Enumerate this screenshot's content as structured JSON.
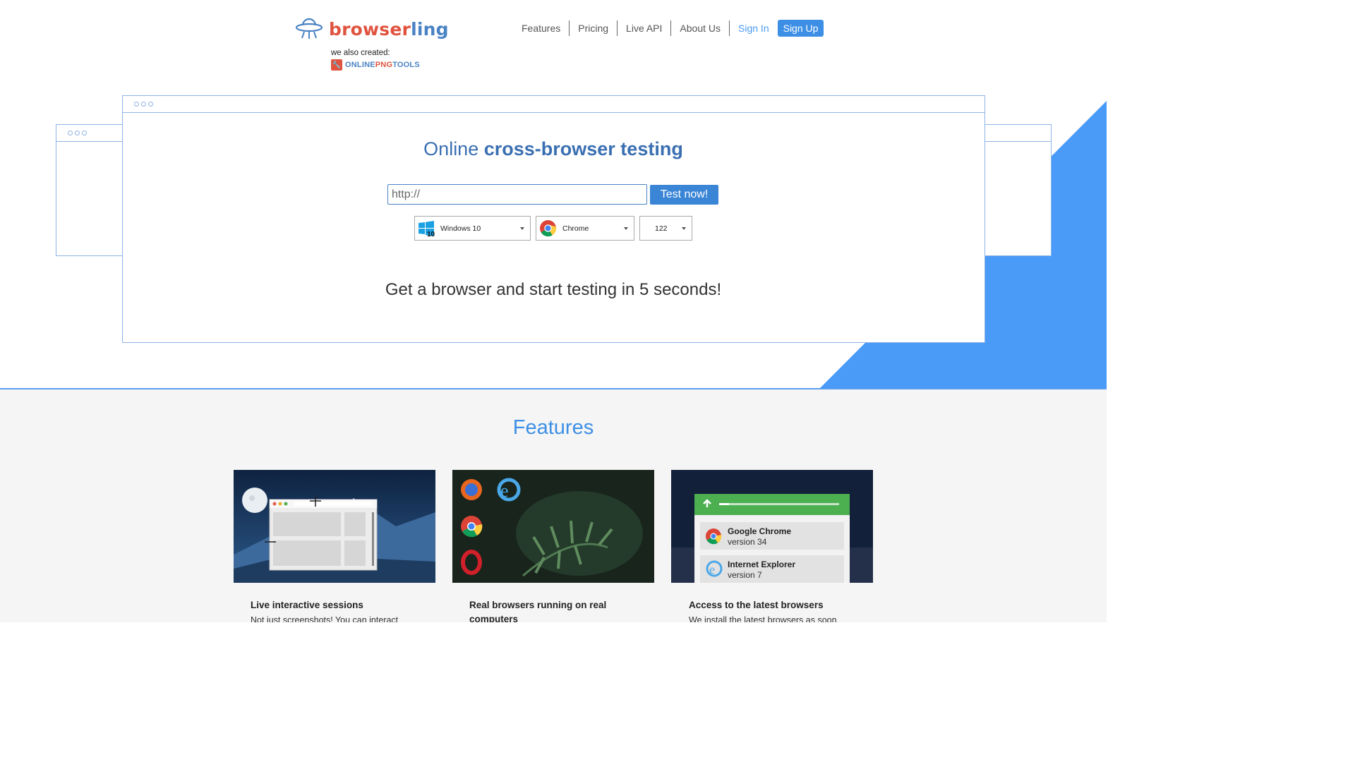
{
  "header": {
    "logo_part1": "browser",
    "logo_part2": "ling",
    "also_created": "we also created:",
    "opt_part1": "ONLINE",
    "opt_part2": "PNG",
    "opt_part3": "TOOLS"
  },
  "nav": {
    "features": "Features",
    "pricing": "Pricing",
    "live_api": "Live API",
    "about": "About Us",
    "sign_in": "Sign In",
    "sign_up": "Sign Up"
  },
  "hero": {
    "title_plain": "Online ",
    "title_bold": "cross-browser testing",
    "url_value": "http://",
    "test_button": "Test now!",
    "os_value": "Windows 10",
    "browser_value": "Chrome",
    "version_value": "122",
    "subtitle": "Get a browser and start testing in 5 seconds!"
  },
  "features": {
    "title": "Features",
    "cards": [
      {
        "heading": "Live interactive sessions",
        "text": "Not just screenshots! You can interact"
      },
      {
        "heading": "Real browsers running on real computers",
        "text": ""
      },
      {
        "heading": "Access to the latest browsers",
        "text": "We install the latest browsers as soon"
      }
    ],
    "card3_items": [
      {
        "name": "Google Chrome",
        "version": "version 34"
      },
      {
        "name": "Internet Explorer",
        "version": "version 7"
      }
    ]
  },
  "colors": {
    "brand_red": "#e0533f",
    "brand_blue": "#4a83c4",
    "accent_blue": "#3d8fe6",
    "hero_triangle": "#4a9af8"
  }
}
